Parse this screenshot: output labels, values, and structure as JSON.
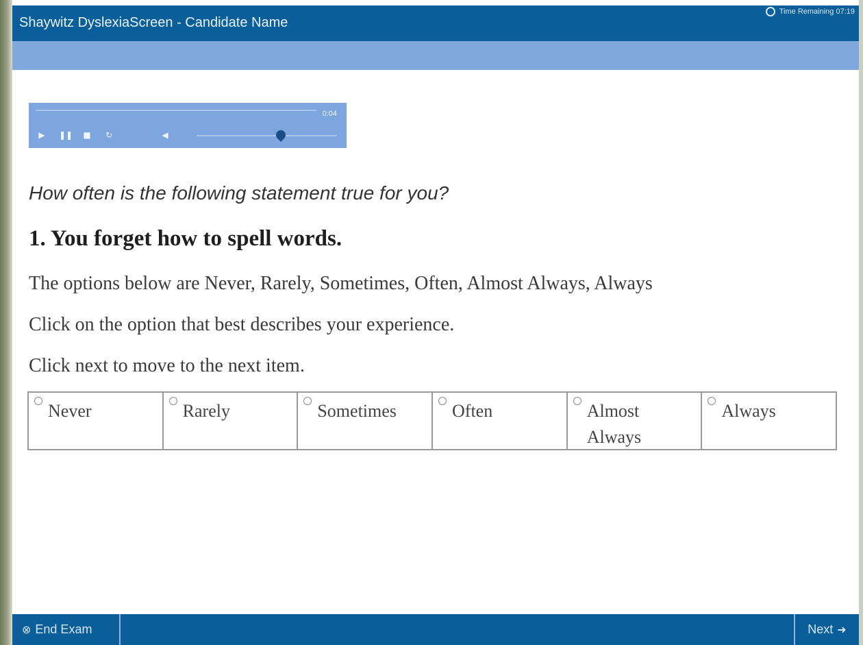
{
  "header": {
    "title": "Shaywitz DyslexiaScreen - Candidate Name",
    "timer_label": "Time Remaining 07:19"
  },
  "player": {
    "time": "0:04",
    "volume_fraction": 0.6,
    "icons": [
      "play-icon",
      "pause-icon",
      "stop-icon",
      "replay-icon",
      "volume-icon"
    ]
  },
  "content": {
    "instruction": "How often is the following statement true for you?",
    "question": "1. You forget how to spell words.",
    "line1": "The options below are Never, Rarely, Sometimes, Often, Almost Always, Always",
    "line2": "Click on the option that best describes your experience.",
    "line3": "Click next to move to the next item."
  },
  "options": [
    "Never",
    "Rarely",
    "Sometimes",
    "Often",
    "Almost Always",
    "Always"
  ],
  "footer": {
    "end_exam": "End Exam",
    "next": "Next"
  }
}
